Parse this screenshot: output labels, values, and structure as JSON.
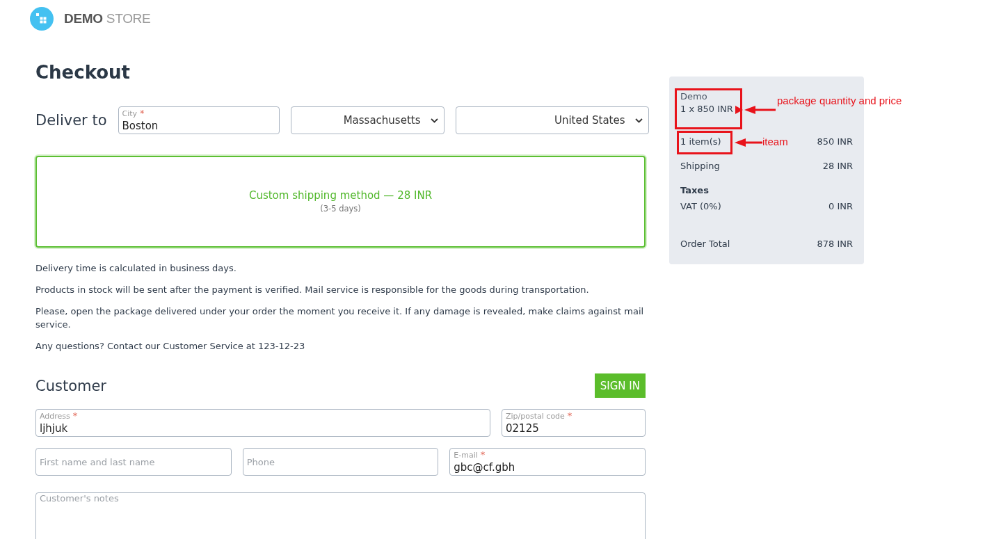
{
  "header": {
    "logo_text": "**DEMO** STORE"
  },
  "title": "Checkout",
  "delivery": {
    "label": "Deliver to",
    "city": {
      "label": "City",
      "required_mark": "*",
      "value": "Boston"
    },
    "state": {
      "value": "Massachusetts"
    },
    "country": {
      "value": "United States"
    }
  },
  "shipping_methods": [
    {
      "name": "Custom shipping method — 28 INR",
      "duration": "(3-5 days)",
      "selected": true
    }
  ],
  "notes": [
    "Delivery time is calculated in business days.",
    "Products in stock will be sent after the payment is verified. Mail service is responsible for the goods during transportation.",
    "Please, open the package delivered under your order the moment you receive it. If any damage is revealed, make claims against mail service.",
    "Any questions? Contact our Customer Service at 123-12-23"
  ],
  "customer": {
    "title": "Customer",
    "sign_in_button": "SIGN IN",
    "field_rows": [
      {
        "fields": [
          {
            "kind": "input",
            "label": "Address",
            "required_mark": "*",
            "value": "ljhjuk"
          },
          {
            "kind": "input",
            "label": "Zip/postal code",
            "required_mark": "*",
            "value": "02125"
          }
        ]
      },
      {
        "fields": [
          {
            "kind": "input",
            "placeholder": "First name and last name"
          },
          {
            "kind": "input",
            "placeholder": "Phone"
          },
          {
            "kind": "input",
            "label": "E-mail",
            "required_mark": "*",
            "value": "gbc@cf.gbh"
          }
        ]
      },
      {
        "fields": [
          {
            "kind": "textarea",
            "placeholder": "Customer's notes"
          }
        ]
      }
    ]
  },
  "order_summary": {
    "product": {
      "name": "Demo",
      "quantity_price": "1 x 850 INR"
    },
    "rows": [
      {
        "kind": "line",
        "label": "1 item(s)",
        "value": "850 INR"
      },
      {
        "kind": "line",
        "label": "Shipping",
        "value": "28 INR"
      },
      {
        "kind": "heading",
        "label": "Taxes"
      },
      {
        "kind": "line",
        "label": "VAT (0%)",
        "value": "0 INR"
      },
      {
        "kind": "total",
        "label": "Order Total",
        "value": "878 INR"
      }
    ]
  },
  "annotations": [
    {
      "text": "package quantity and price"
    },
    {
      "text": "iteam"
    }
  ]
}
